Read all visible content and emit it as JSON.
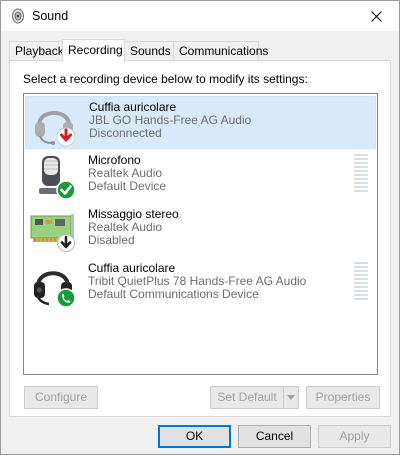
{
  "window": {
    "title": "Sound",
    "icon": "speaker-icon"
  },
  "tabs": [
    {
      "label": "Playback",
      "active": false
    },
    {
      "label": "Recording",
      "active": true
    },
    {
      "label": "Sounds",
      "active": false
    },
    {
      "label": "Communications",
      "active": false
    }
  ],
  "instruction": "Select a recording device below to modify its settings:",
  "devices": [
    {
      "name": "Cuffia auricolare",
      "detail": "JBL GO Hands-Free AG Audio",
      "status": "Disconnected",
      "icon": "headset-icon",
      "badge": "down-arrow-red",
      "selected": true
    },
    {
      "name": "Microfono",
      "detail": "Realtek Audio",
      "status": "Default Device",
      "icon": "microphone-icon",
      "badge": "checkmark-green",
      "selected": false
    },
    {
      "name": "Missaggio stereo",
      "detail": "Realtek Audio",
      "status": "Disabled",
      "icon": "sound-card-icon",
      "badge": "down-arrow-black",
      "selected": false
    },
    {
      "name": "Cuffia auricolare",
      "detail": "Tribit QuietPlus 78 Hands-Free AG Audio",
      "status": "Default Communications Device",
      "icon": "headset-icon",
      "badge": "phone-green",
      "selected": false
    }
  ],
  "buttons": {
    "configure": "Configure",
    "set_default": "Set Default",
    "properties": "Properties",
    "ok": "OK",
    "cancel": "Cancel",
    "apply": "Apply"
  },
  "colors": {
    "accent": "#0078d7",
    "selection": "#d8eaf9",
    "ok_badge": "#1a9a3a",
    "error_badge": "#d42020"
  }
}
